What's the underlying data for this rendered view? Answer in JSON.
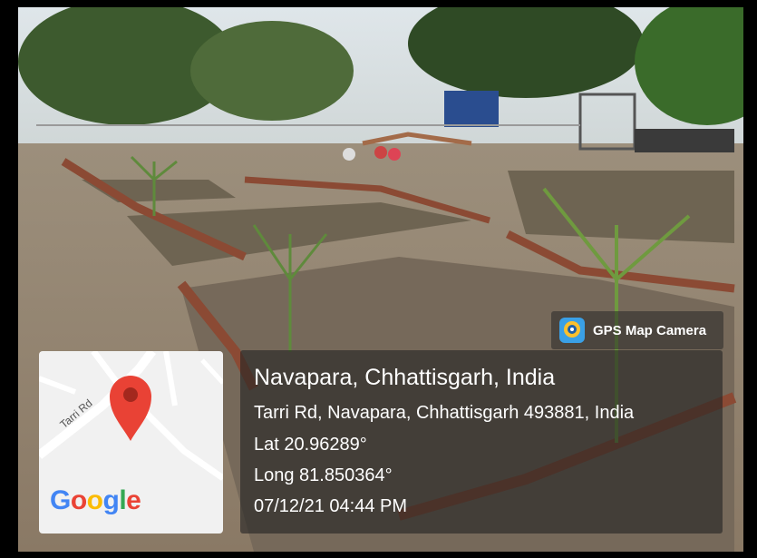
{
  "badge": {
    "label": "GPS Map Camera",
    "icon": "camera-lens-icon"
  },
  "location": {
    "title": "Navapara, Chhattisgarh, India",
    "address": "Tarri Rd, Navapara, Chhattisgarh 493881, India",
    "lat": "Lat 20.96289°",
    "long": "Long 81.850364°",
    "timestamp": "07/12/21 04:44 PM"
  },
  "map": {
    "road_label": "Tarri Rd",
    "pin_icon": "map-pin-icon",
    "pin_color": "#E94235"
  },
  "google": {
    "letters": [
      "G",
      "o",
      "o",
      "g",
      "l",
      "e"
    ],
    "colors": [
      "#4285F4",
      "#EA4335",
      "#FBBC05",
      "#4285F4",
      "#34A853",
      "#EA4335"
    ]
  }
}
